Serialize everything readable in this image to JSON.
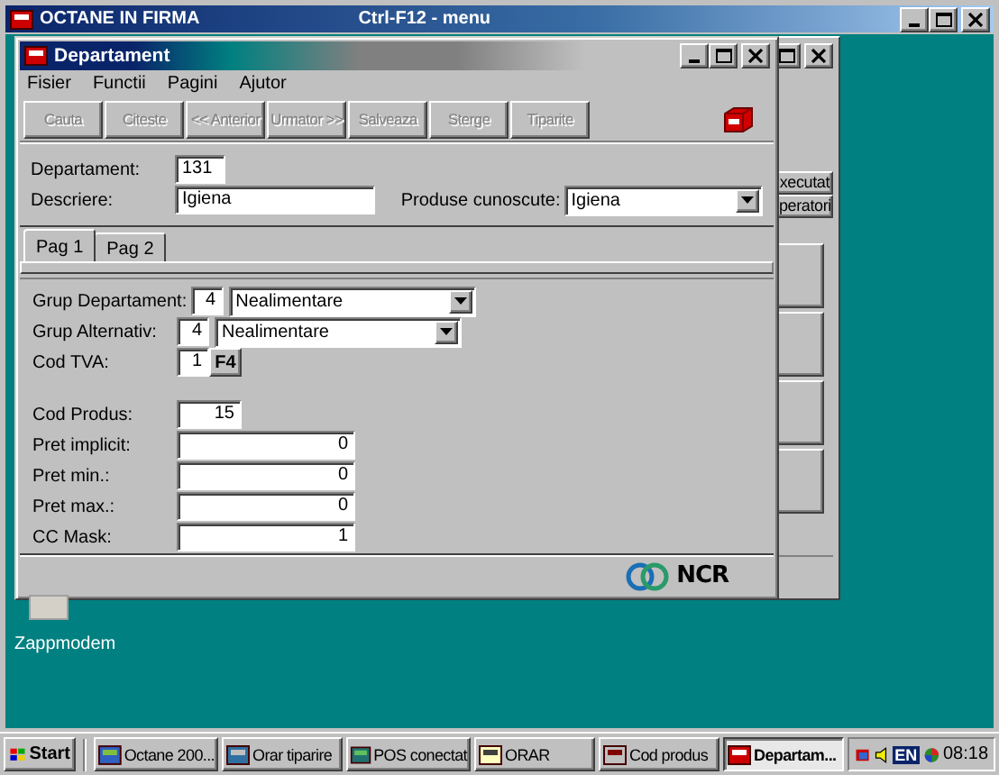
{
  "outer_window": {
    "title": "OCTANE IN FIRMA",
    "hint": "Ctrl-F12 - menu"
  },
  "back_window": {
    "buttons": [
      "xecutat",
      "peratori"
    ]
  },
  "window": {
    "title": "Departament",
    "menu": [
      "Fisier",
      "Functii",
      "Pagini",
      "Ajutor"
    ],
    "toolbar": [
      {
        "label": "Cauta",
        "disabled": true
      },
      {
        "label": "Citeste",
        "disabled": true
      },
      {
        "label": "<< Anterior",
        "disabled": true
      },
      {
        "label": "Urmator >>",
        "disabled": true
      },
      {
        "label": "Salveaza",
        "disabled": true
      },
      {
        "label": "Sterge",
        "disabled": true
      },
      {
        "label": "Tiparite",
        "disabled": true
      }
    ],
    "header": {
      "departament": {
        "label": "Departament:",
        "value": "131"
      },
      "descriere": {
        "label": "Descriere:",
        "value": "Igiena"
      },
      "produse": {
        "label": "Produse cunoscute:",
        "value": "Igiena"
      }
    },
    "tabs": [
      {
        "label": "Pag 1",
        "selected": true
      },
      {
        "label": "Pag 2",
        "selected": false
      }
    ],
    "rows": [
      {
        "kind": "combo",
        "label": "Grup Departament:",
        "code": "4",
        "value": "Nealimentare"
      },
      {
        "kind": "combo",
        "label": "Grup Alternativ:",
        "code": "4",
        "value": "Nealimentare"
      },
      {
        "kind": "code_key",
        "label": "Cod TVA:",
        "code": "1",
        "key": "F4"
      },
      {
        "kind": "short",
        "label": "Cod Produs:",
        "value": "15"
      },
      {
        "kind": "number",
        "label": "Pret implicit:",
        "value": "0"
      },
      {
        "kind": "number",
        "label": "Pret min.:",
        "value": "0"
      },
      {
        "kind": "number",
        "label": "Pret max.:",
        "value": "0"
      },
      {
        "kind": "number",
        "label": "CC Mask:",
        "value": "1"
      }
    ],
    "footer": {
      "logo": "NCR"
    }
  },
  "desktop_icons": [
    {
      "label": "Zappmodem"
    }
  ],
  "taskbar": {
    "start": "Start",
    "tasks": [
      {
        "label": "Octane 200...",
        "selected": false
      },
      {
        "label": "Orar tiparire",
        "selected": false
      },
      {
        "label": "POS conectat",
        "selected": false
      },
      {
        "label": "ORAR",
        "selected": false
      },
      {
        "label": "Cod produs",
        "selected": false
      },
      {
        "label": "Departam...",
        "selected": true
      }
    ],
    "language": "EN",
    "clock": "08:18"
  }
}
